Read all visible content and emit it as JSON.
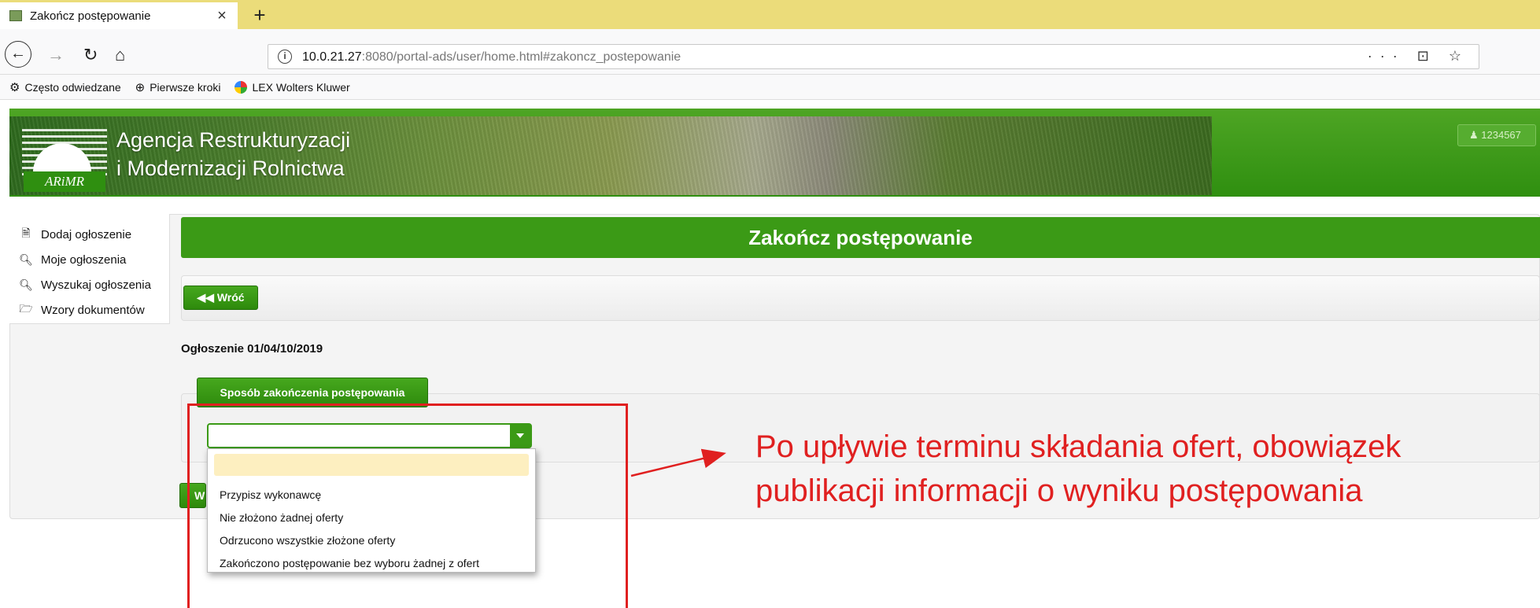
{
  "browser": {
    "tab_title": "Zakończ postępowanie",
    "tab_close": "×",
    "new_tab": "+",
    "url_host": "10.0.21.27",
    "url_rest": ":8080/portal-ads/user/home.html#zakoncz_postepowanie",
    "url_actions": "··· ⊡ ☆",
    "bookmarks": [
      {
        "label": "Często odwiedzane",
        "icon": "gear-icon"
      },
      {
        "label": "Pierwsze kroki",
        "icon": "globe-icon"
      },
      {
        "label": "LEX Wolters Kluwer",
        "icon": "lex-icon"
      }
    ]
  },
  "header": {
    "agency_line1": "Agencja Restrukturyzacji",
    "agency_line2": "i Modernizacji Rolnictwa",
    "logo_abbr": "ARiMR",
    "user_badge": "1234567"
  },
  "sidebar": {
    "items": [
      {
        "label": "Dodaj ogłoszenie",
        "icon": "document-icon"
      },
      {
        "label": "Moje ogłoszenia",
        "icon": "search-icon"
      },
      {
        "label": "Wyszukaj ogłoszenia",
        "icon": "search-icon"
      },
      {
        "label": "Wzory dokumentów",
        "icon": "folder-icon"
      }
    ]
  },
  "main": {
    "page_title": "Zakończ postępowanie",
    "back_button": "Wróć",
    "announcement": "Ogłoszenie 01/04/10/2019",
    "method_label": "Sposób zakończenia postępowania",
    "select_value": "",
    "save_button_partial": "W",
    "dropdown_options": [
      "Przypisz wykonawcę",
      "Nie złożono żadnej oferty",
      "Odrzucono wszystkie złożone oferty",
      "Zakończono postępowanie bez wyboru żadnej z ofert"
    ]
  },
  "annotation": {
    "text_line1": "Po upływie terminu składania ofert, obowiązek",
    "text_line2": "publikacji informacji o wyniku postępowania",
    "color": "#e02020"
  },
  "colors": {
    "accent_green": "#3b9a16",
    "tabbar": "#ebdc7a"
  }
}
